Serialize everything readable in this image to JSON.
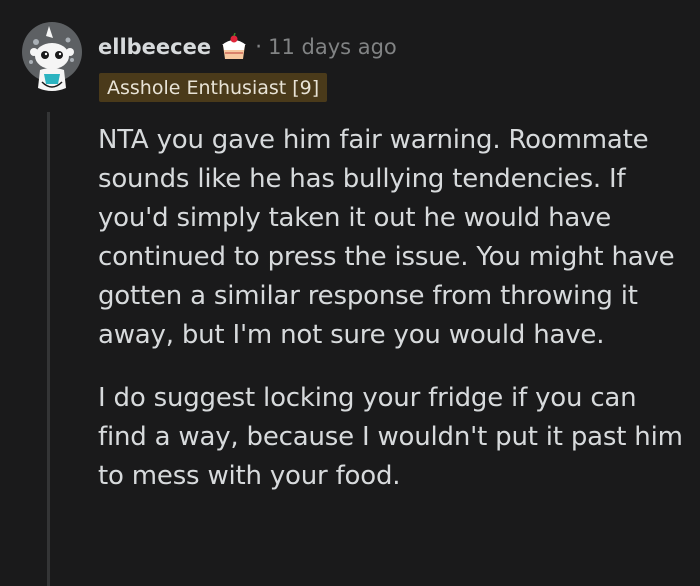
{
  "comment": {
    "username": "ellbeecee",
    "separator": "·",
    "time_ago": "11 days ago",
    "flair": "Asshole Enthusiast [9]",
    "paragraphs": [
      "NTA you gave him fair warning. Roommate sounds like he has bullying tendencies. If you'd simply taken it out he would have continued to press the issue. You might have gotten a similar response from throwing it away, but I'm not sure you would have.",
      "I do suggest locking your fridge if you can find a way, because I wouldn't put it past him to mess with your food."
    ]
  },
  "icons": {
    "avatar": "snoo-avatar-icon",
    "cake_day": "cake-icon"
  },
  "colors": {
    "background": "#1a1a1b",
    "text": "#d7dadc",
    "meta_text": "#818384",
    "flair_bg": "#4a3a1a",
    "thread_line": "#343536"
  }
}
